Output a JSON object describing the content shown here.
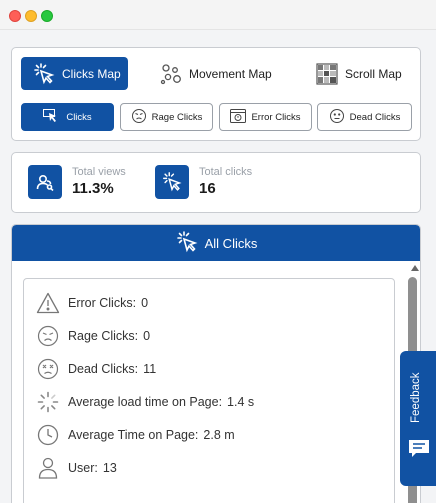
{
  "window": {
    "controls": [
      "close",
      "minimize",
      "maximize"
    ]
  },
  "map_tabs": [
    {
      "label": "Clicks Map",
      "icon": "click-cursor-icon",
      "active": true
    },
    {
      "label": "Movement Map",
      "icon": "movement-icon",
      "active": false
    },
    {
      "label": "Scroll Map",
      "icon": "scroll-grid-icon",
      "active": false
    }
  ],
  "filters": [
    {
      "label": "Clicks",
      "icon": "pointer-icon",
      "active": true
    },
    {
      "label": "Rage Clicks",
      "icon": "rage-face-icon",
      "active": false
    },
    {
      "label": "Error Clicks",
      "icon": "error-window-icon",
      "active": false
    },
    {
      "label": "Dead Clicks",
      "icon": "neutral-face-icon",
      "active": false
    }
  ],
  "stats": {
    "views": {
      "label": "Total views",
      "value": "11.3%",
      "icon": "users-icon"
    },
    "clicks": {
      "label": "Total clicks",
      "value": "16",
      "icon": "click-cursor-icon"
    }
  },
  "panel": {
    "title": "All Clicks",
    "rows": [
      {
        "label": "Error Clicks:",
        "value": "0",
        "icon": "warning-icon"
      },
      {
        "label": "Rage Clicks:",
        "value": "0",
        "icon": "angry-face-icon"
      },
      {
        "label": "Dead Clicks:",
        "value": "11",
        "icon": "dead-face-icon"
      },
      {
        "label": "Average load time on Page:",
        "value": "1.4 s",
        "icon": "loading-spinner-icon"
      },
      {
        "label": "Average Time on Page:",
        "value": "2.8 m",
        "icon": "clock-icon"
      },
      {
        "label": "User:",
        "value": "13",
        "icon": "user-icon"
      }
    ]
  },
  "feedback": {
    "label": "Feedback",
    "icon": "chat-icon"
  },
  "colors": {
    "primary": "#1152a3",
    "border": "#c9ccd1",
    "muted": "#9aa0a8"
  }
}
